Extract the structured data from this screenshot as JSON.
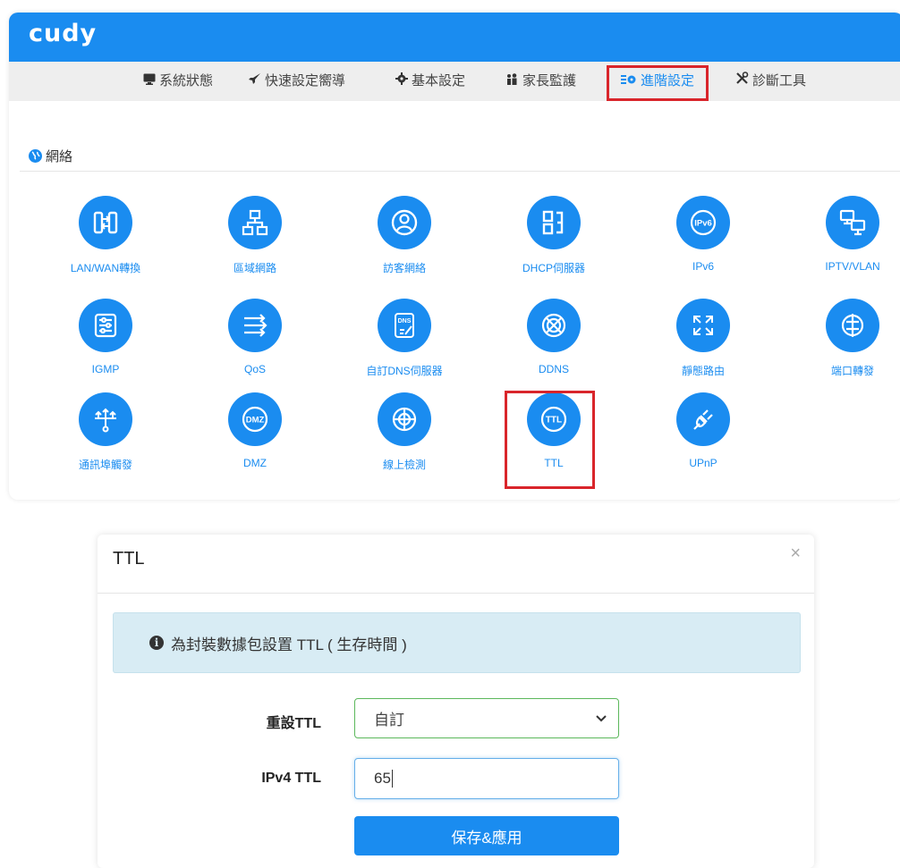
{
  "brand": {
    "logo_text": "cudy"
  },
  "nav": {
    "items": [
      {
        "label": "系統狀態",
        "icon": "monitor-icon"
      },
      {
        "label": "快速設定嚮導",
        "icon": "rocket-icon"
      },
      {
        "label": "基本設定",
        "icon": "gear-icon"
      },
      {
        "label": "家長監護",
        "icon": "family-icon"
      },
      {
        "label": "進階設定",
        "icon": "advanced-settings-icon",
        "active": true
      },
      {
        "label": "診斷工具",
        "icon": "tools-icon"
      }
    ]
  },
  "section": {
    "title": "網絡",
    "icon": "globe-icon"
  },
  "grid": {
    "items": [
      {
        "label": "LAN/WAN轉換",
        "icon": "lan-wan-switch-icon"
      },
      {
        "label": "區域網路",
        "icon": "network-tree-icon"
      },
      {
        "label": "訪客網絡",
        "icon": "guest-user-icon"
      },
      {
        "label": "DHCP伺服器",
        "icon": "dhcp-icon"
      },
      {
        "label": "IPv6",
        "icon": "ipv6-icon"
      },
      {
        "label": "IPTV/VLAN",
        "icon": "iptv-icon"
      },
      {
        "label": "IGMP",
        "icon": "igmp-icon"
      },
      {
        "label": "QoS",
        "icon": "qos-arrows-icon"
      },
      {
        "label": "自訂DNS伺服器",
        "icon": "dns-edit-icon"
      },
      {
        "label": "DDNS",
        "icon": "ddns-icon"
      },
      {
        "label": "靜態路由",
        "icon": "static-route-icon"
      },
      {
        "label": "端口轉發",
        "icon": "port-forward-icon"
      },
      {
        "label": "通訊埠觸發",
        "icon": "port-trigger-icon"
      },
      {
        "label": "DMZ",
        "icon": "dmz-icon"
      },
      {
        "label": "線上檢測",
        "icon": "online-detect-icon"
      },
      {
        "label": "TTL",
        "icon": "ttl-icon",
        "highlighted": true
      },
      {
        "label": "UPnP",
        "icon": "upnp-plug-icon"
      }
    ]
  },
  "modal": {
    "title": "TTL",
    "close_glyph": "×",
    "info_text": "為封裝數據包設置 TTL ( 生存時間 )",
    "reset_ttl_label": "重設TTL",
    "reset_ttl_value": "自訂",
    "ipv4_ttl_label": "IPv4 TTL",
    "ipv4_ttl_value": "65",
    "save_label": "保存&應用"
  },
  "colors": {
    "accent": "#1a8cf0",
    "highlight": "#d9252b",
    "alert_bg": "#d8ecf4",
    "valid_border": "#5cb85c"
  }
}
